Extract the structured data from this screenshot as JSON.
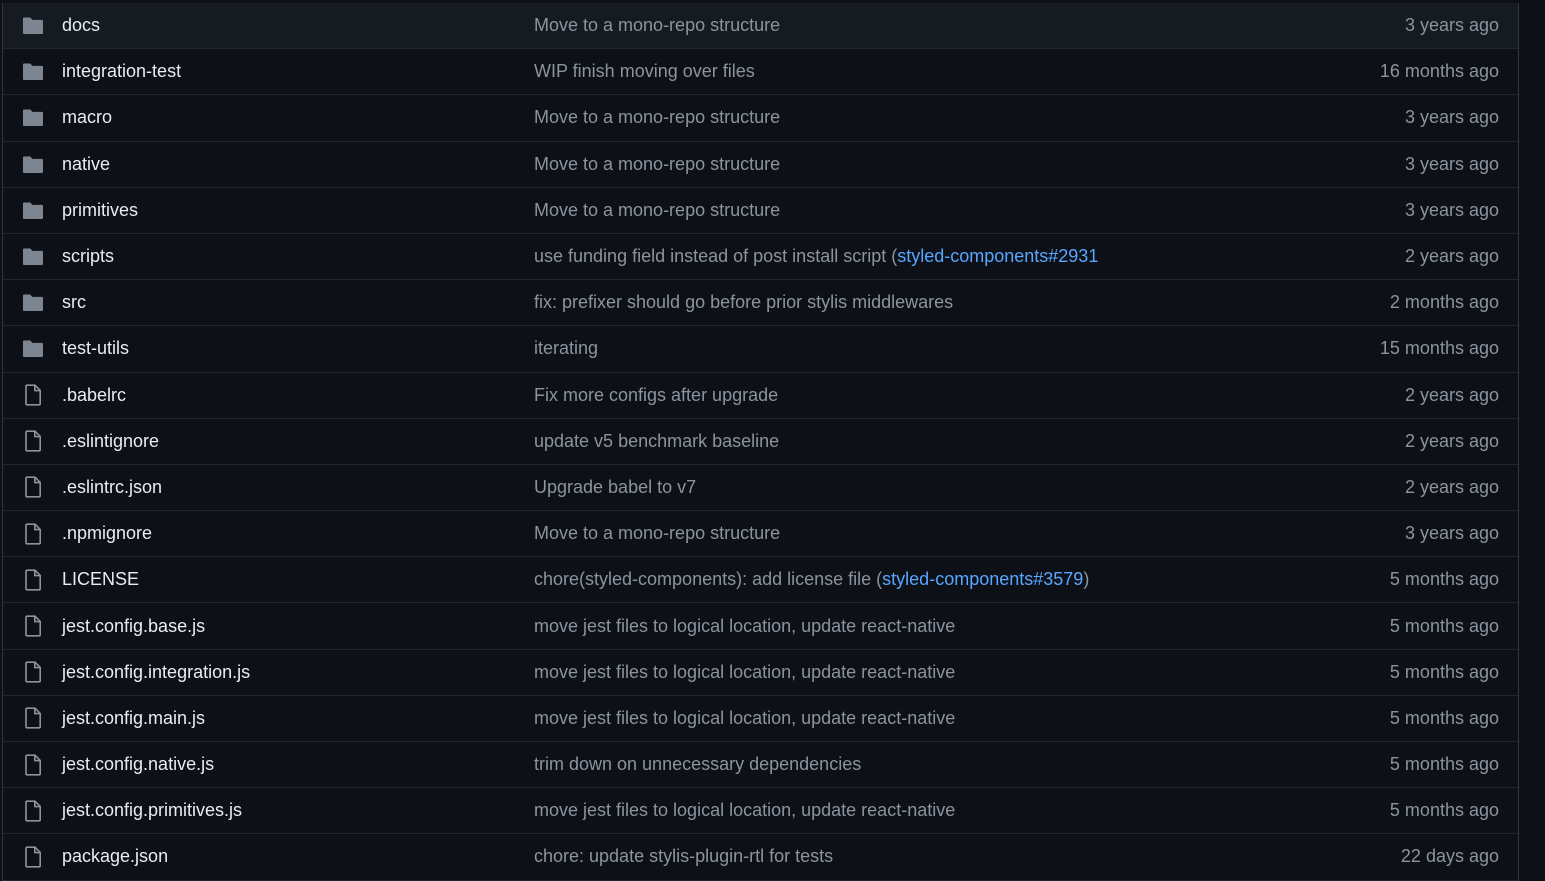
{
  "colors": {
    "background": "#0d1117",
    "text": "#e6edf3",
    "muted": "#8b949e",
    "link": "#58a6ff",
    "folder_icon": "#7d8590"
  },
  "files": [
    {
      "name": "docs",
      "type": "folder",
      "icon": "folder-icon",
      "message": "Move to a mono-repo structure",
      "age": "3 years ago"
    },
    {
      "name": "integration-test",
      "type": "folder",
      "icon": "folder-icon",
      "message": "WIP finish moving over files",
      "age": "16 months ago"
    },
    {
      "name": "macro",
      "type": "folder",
      "icon": "folder-icon",
      "message": "Move to a mono-repo structure",
      "age": "3 years ago"
    },
    {
      "name": "native",
      "type": "folder",
      "icon": "folder-icon",
      "message": "Move to a mono-repo structure",
      "age": "3 years ago"
    },
    {
      "name": "primitives",
      "type": "folder",
      "icon": "folder-icon",
      "message": "Move to a mono-repo structure",
      "age": "3 years ago"
    },
    {
      "name": "scripts",
      "type": "folder",
      "icon": "folder-icon",
      "message": "use funding field instead of post install script (",
      "link": "styled-components#2931",
      "age": "2 years ago"
    },
    {
      "name": "src",
      "type": "folder",
      "icon": "folder-icon",
      "message": "fix: prefixer should go before prior stylis middlewares",
      "age": "2 months ago"
    },
    {
      "name": "test-utils",
      "type": "folder",
      "icon": "folder-icon",
      "message": "iterating",
      "age": "15 months ago"
    },
    {
      "name": ".babelrc",
      "type": "file",
      "icon": "file-icon",
      "message": "Fix more configs after upgrade",
      "age": "2 years ago"
    },
    {
      "name": ".eslintignore",
      "type": "file",
      "icon": "file-icon",
      "message": "update v5 benchmark baseline",
      "age": "2 years ago"
    },
    {
      "name": ".eslintrc.json",
      "type": "file",
      "icon": "file-icon",
      "message": "Upgrade babel to v7",
      "age": "2 years ago"
    },
    {
      "name": ".npmignore",
      "type": "file",
      "icon": "file-icon",
      "message": "Move to a mono-repo structure",
      "age": "3 years ago"
    },
    {
      "name": "LICENSE",
      "type": "file",
      "icon": "file-icon",
      "message": "chore(styled-components): add license file (",
      "link": "styled-components#3579",
      "suffix": ")",
      "age": "5 months ago"
    },
    {
      "name": "jest.config.base.js",
      "type": "file",
      "icon": "file-icon",
      "message": "move jest files to logical location, update react-native",
      "age": "5 months ago"
    },
    {
      "name": "jest.config.integration.js",
      "type": "file",
      "icon": "file-icon",
      "message": "move jest files to logical location, update react-native",
      "age": "5 months ago"
    },
    {
      "name": "jest.config.main.js",
      "type": "file",
      "icon": "file-icon",
      "message": "move jest files to logical location, update react-native",
      "age": "5 months ago"
    },
    {
      "name": "jest.config.native.js",
      "type": "file",
      "icon": "file-icon",
      "message": "trim down on unnecessary dependencies",
      "age": "5 months ago"
    },
    {
      "name": "jest.config.primitives.js",
      "type": "file",
      "icon": "file-icon",
      "message": "move jest files to logical location, update react-native",
      "age": "5 months ago"
    },
    {
      "name": "package.json",
      "type": "file",
      "icon": "file-icon",
      "message": "chore: update stylis-plugin-rtl for tests",
      "age": "22 days ago"
    }
  ]
}
